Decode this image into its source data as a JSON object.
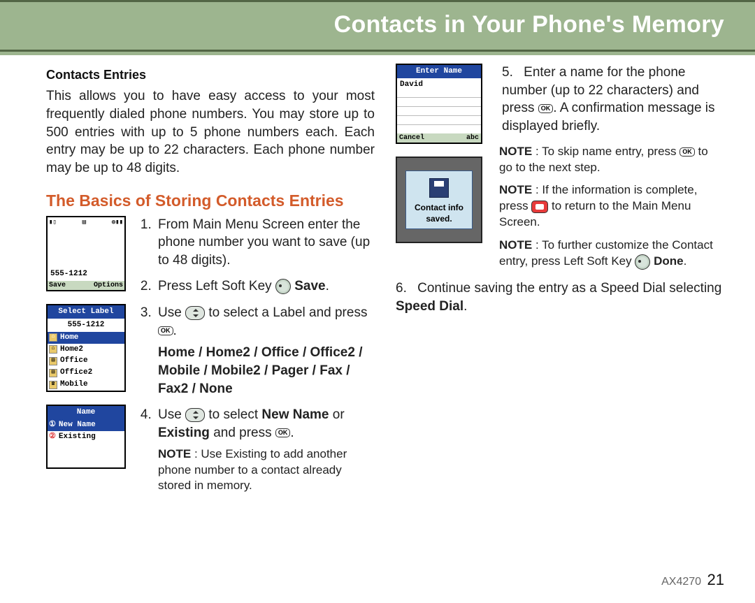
{
  "header": {
    "title": "Contacts in Your Phone's Memory"
  },
  "col_left": {
    "sub_title": "Contacts Entries",
    "intro": "This allows you to have easy access to your most frequently dialed phone numbers. You may store up to 500 entries with up to 5 phone numbers each. Each entry may be up to 22 characters. Each phone number may be up to 48 digits.",
    "section_title": "The Basics of Storing Contacts Entries",
    "step1": "From Main Menu Screen enter the phone number you want to save (up to 48 digits).",
    "step2_a": "Press Left Soft Key ",
    "step2_b": "Save",
    "step2_c": ".",
    "step3_a": "Use ",
    "step3_b": " to select a Label and press ",
    "step3_c": ".",
    "step3_labels": "Home / Home2 / Office / Office2 / Mobile / Mobile2 / Pager / Fax / Fax2 / None",
    "step4_a": "Use ",
    "step4_b": " to select ",
    "step4_new": "New Name",
    "step4_or": " or ",
    "step4_ex": "Existing",
    "step4_c": " and press ",
    "step4_d": ".",
    "note4_label": "NOTE",
    "note4": " : Use Existing to add another phone number to a contact already stored in memory.",
    "screens": {
      "dial": {
        "number": "555-1212",
        "softL": "Save",
        "softR": "Options"
      },
      "select_label": {
        "title": "Select Label",
        "number": "555-1212",
        "items": [
          "Home",
          "Home2",
          "Office",
          "Office2",
          "Mobile"
        ]
      },
      "name": {
        "title": "Name",
        "items": [
          "New Name",
          "Existing"
        ]
      }
    }
  },
  "col_right": {
    "enter_screen": {
      "title": "Enter Name",
      "value": "David",
      "softL": "Cancel",
      "softR": "abc"
    },
    "saved_screen": {
      "text1": "Contact info",
      "text2": "saved."
    },
    "step5_a": "Enter a name for the phone number (up to 22 characters) and press ",
    "step5_b": ". A confirmation message is displayed briefly.",
    "note1_label": "NOTE",
    "note1_a": " : To skip name entry, press ",
    "note1_b": " to go to the next step.",
    "note2_label": "NOTE",
    "note2_a": " : If the information is complete, press ",
    "note2_b": " to return to the Main Menu Screen.",
    "note3_label": "NOTE",
    "note3_a": " : To further customize the Contact entry, press Left Soft Key ",
    "note3_done": "Done",
    "note3_b": ".",
    "step6_a": "Continue saving the entry as a Speed Dial selecting ",
    "step6_b": "Speed Dial",
    "step6_c": "."
  },
  "footer": {
    "model": "AX4270",
    "page": "21"
  }
}
